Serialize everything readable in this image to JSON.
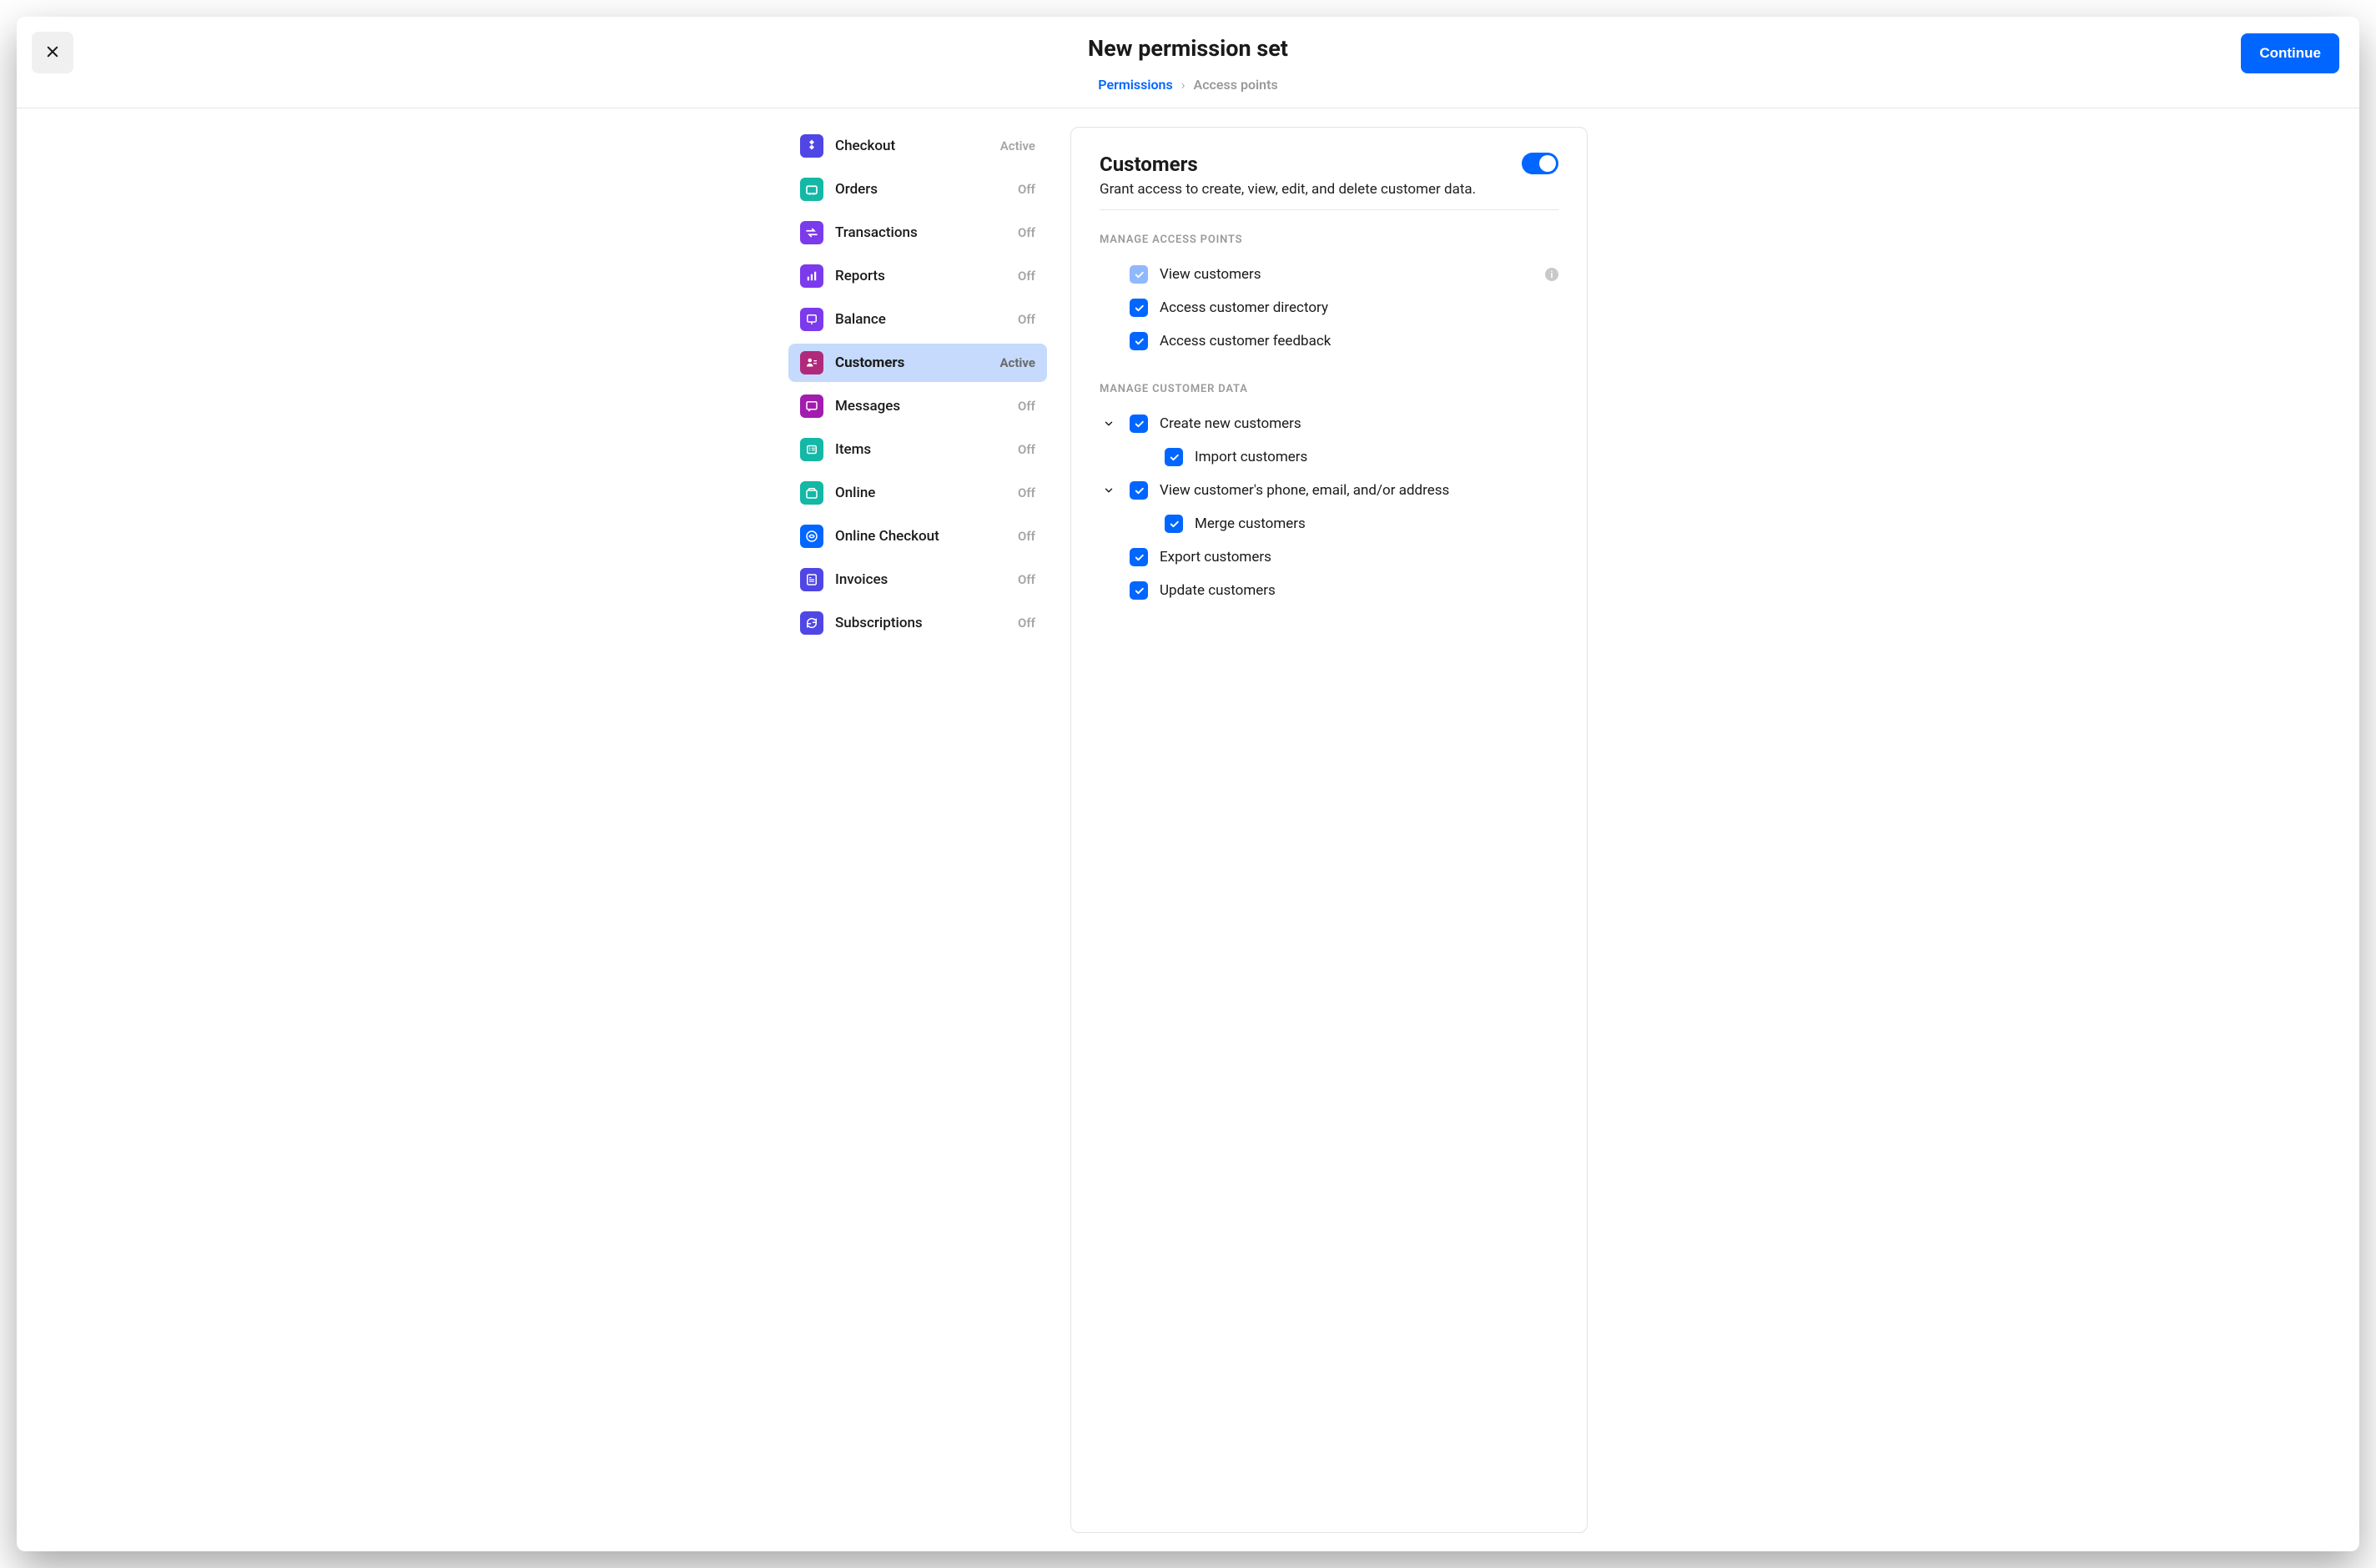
{
  "header": {
    "title": "New permission set",
    "continue_label": "Continue"
  },
  "breadcrumb": {
    "current": "Permissions",
    "next": "Access points"
  },
  "sidebar": {
    "items": [
      {
        "label": "Checkout",
        "status": "Active",
        "icon": "checkout-icon",
        "color": "bg-indigo",
        "selected": false
      },
      {
        "label": "Orders",
        "status": "Off",
        "icon": "orders-icon",
        "color": "bg-teal",
        "selected": false
      },
      {
        "label": "Transactions",
        "status": "Off",
        "icon": "transactions-icon",
        "color": "bg-violet",
        "selected": false
      },
      {
        "label": "Reports",
        "status": "Off",
        "icon": "reports-icon",
        "color": "bg-purple",
        "selected": false
      },
      {
        "label": "Balance",
        "status": "Off",
        "icon": "balance-icon",
        "color": "bg-purple2",
        "selected": false
      },
      {
        "label": "Customers",
        "status": "Active",
        "icon": "customers-icon",
        "color": "bg-pink",
        "selected": true
      },
      {
        "label": "Messages",
        "status": "Off",
        "icon": "messages-icon",
        "color": "bg-magenta",
        "selected": false
      },
      {
        "label": "Items",
        "status": "Off",
        "icon": "items-icon",
        "color": "bg-teal2",
        "selected": false
      },
      {
        "label": "Online",
        "status": "Off",
        "icon": "online-icon",
        "color": "bg-teal3",
        "selected": false
      },
      {
        "label": "Online Checkout",
        "status": "Off",
        "icon": "online-checkout-icon",
        "color": "bg-blue",
        "selected": false
      },
      {
        "label": "Invoices",
        "status": "Off",
        "icon": "invoices-icon",
        "color": "bg-indigo2",
        "selected": false
      },
      {
        "label": "Subscriptions",
        "status": "Off",
        "icon": "subscriptions-icon",
        "color": "bg-indigo3",
        "selected": false
      }
    ]
  },
  "panel": {
    "title": "Customers",
    "description": "Grant access to create, view, edit, and delete customer data.",
    "toggle_on": true,
    "sections": [
      {
        "heading": "MANAGE ACCESS POINTS",
        "items": [
          {
            "label": "View customers",
            "checked": true,
            "disabled": true,
            "info": true,
            "indent": 0,
            "expandable": false
          },
          {
            "label": "Access customer directory",
            "checked": true,
            "disabled": false,
            "info": false,
            "indent": 0,
            "expandable": false
          },
          {
            "label": "Access customer feedback",
            "checked": true,
            "disabled": false,
            "info": false,
            "indent": 0,
            "expandable": false
          }
        ]
      },
      {
        "heading": "MANAGE CUSTOMER DATA",
        "items": [
          {
            "label": "Create new customers",
            "checked": true,
            "disabled": false,
            "info": false,
            "indent": 0,
            "expandable": true,
            "expanded": true
          },
          {
            "label": "Import customers",
            "checked": true,
            "disabled": false,
            "info": false,
            "indent": 1,
            "expandable": false
          },
          {
            "label": "View customer's phone, email, and/or address",
            "checked": true,
            "disabled": false,
            "info": false,
            "indent": 0,
            "expandable": true,
            "expanded": true
          },
          {
            "label": "Merge customers",
            "checked": true,
            "disabled": false,
            "info": false,
            "indent": 1,
            "expandable": false
          },
          {
            "label": "Export customers",
            "checked": true,
            "disabled": false,
            "info": false,
            "indent": 0,
            "expandable": false
          },
          {
            "label": "Update customers",
            "checked": true,
            "disabled": false,
            "info": false,
            "indent": 0,
            "expandable": false
          }
        ]
      }
    ]
  }
}
